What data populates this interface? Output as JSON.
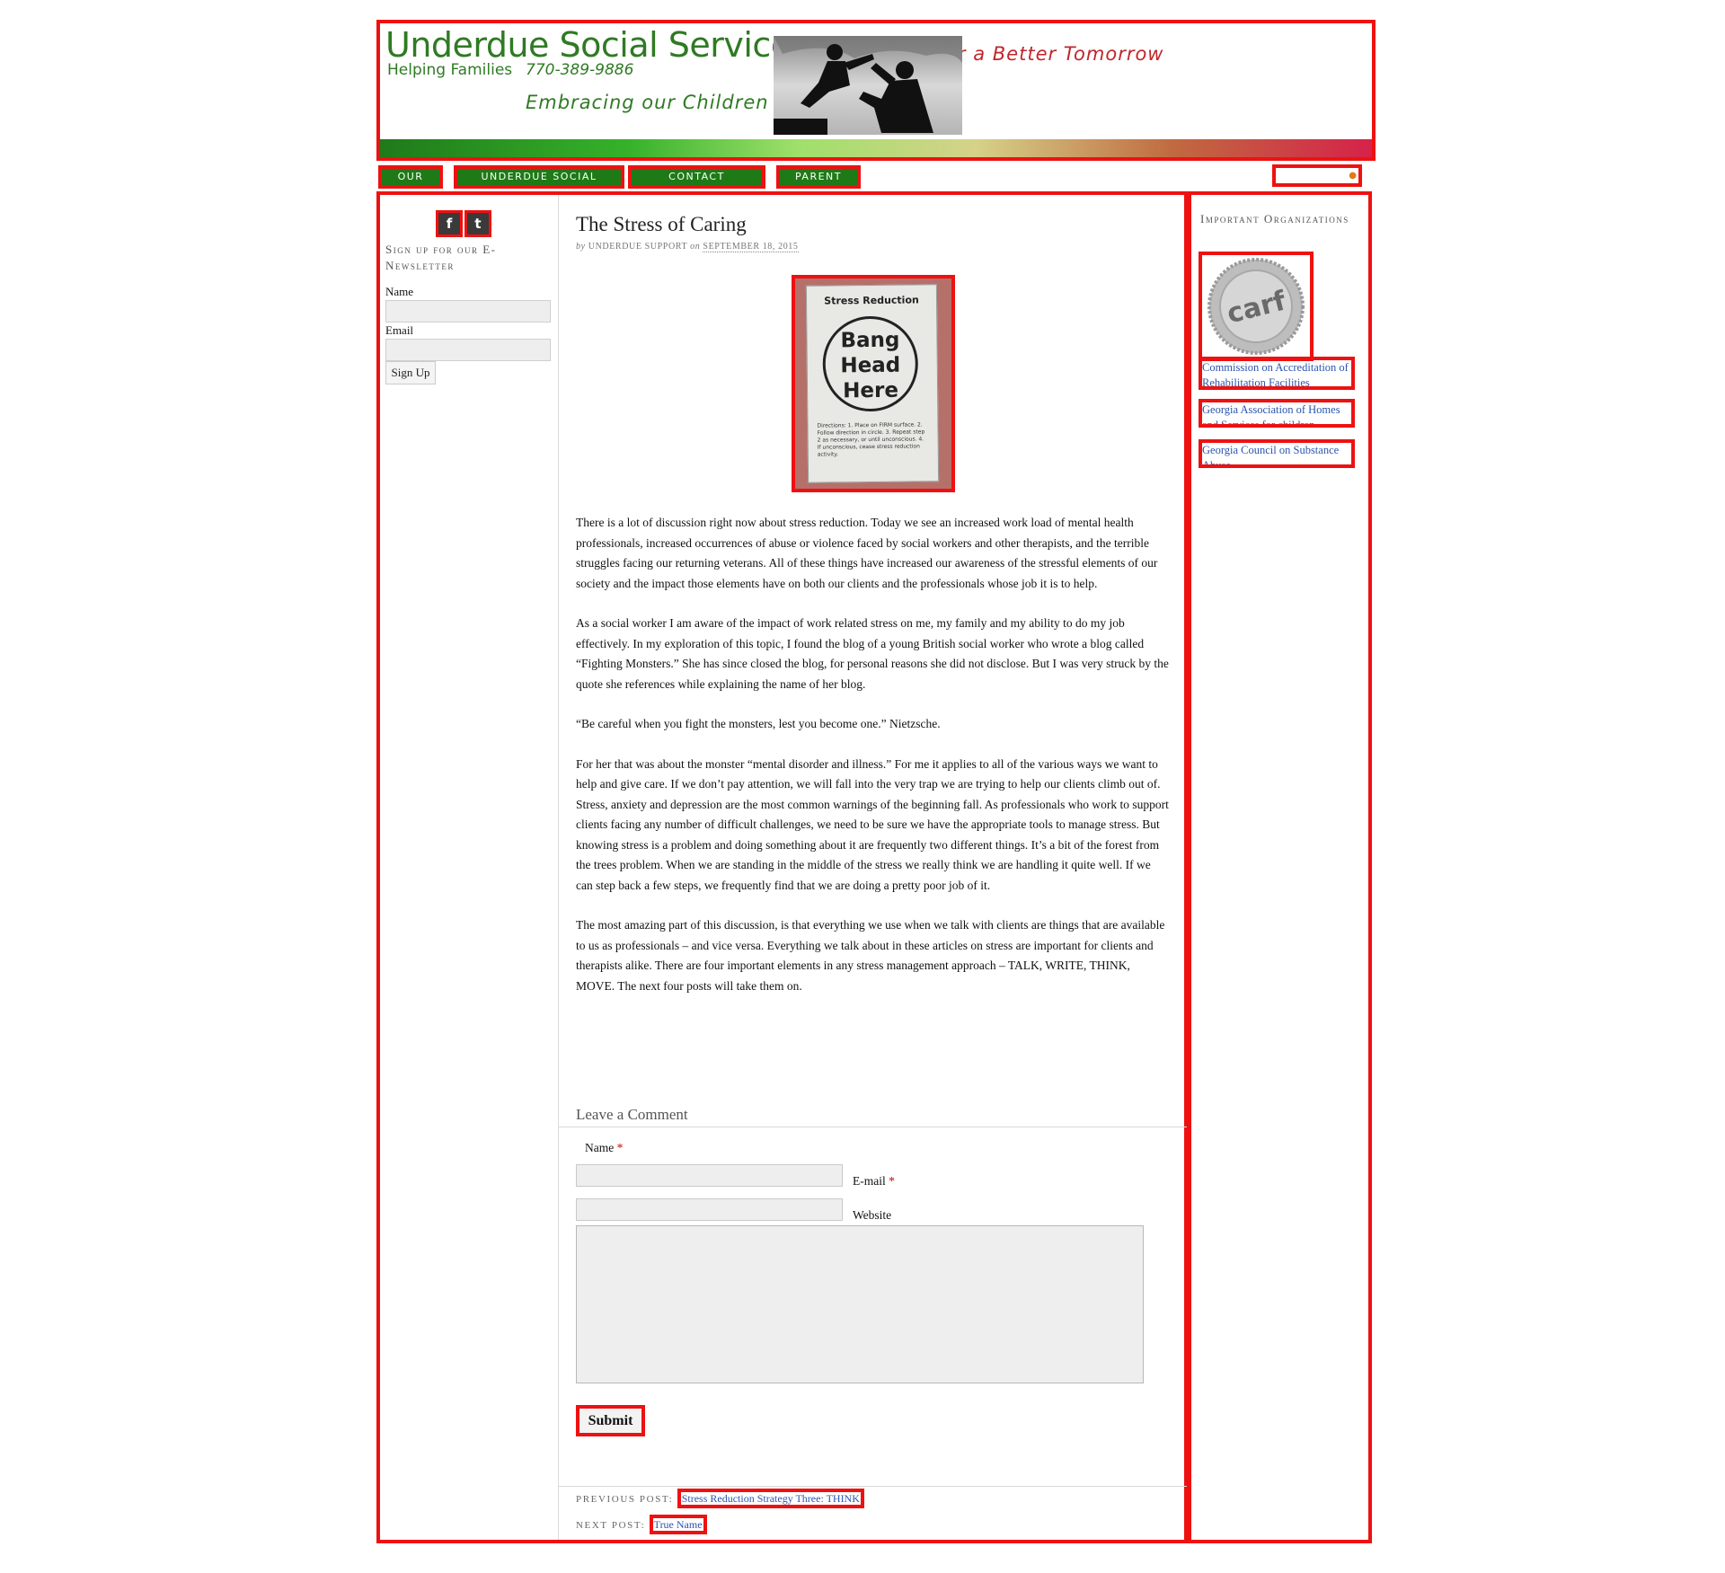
{
  "header": {
    "site_title": "Underdue Social Services",
    "tagline": "Helping Families",
    "phone": "770-389-9886",
    "slogan_green": "Embracing our Children",
    "slogan_red": "For a Better Tomorrow",
    "photo_icon": "header-photo-silhouette"
  },
  "nav": {
    "items": [
      {
        "label": "OUR BLOG"
      },
      {
        "label": "UNDERDUE SOCIAL SERVICES"
      },
      {
        "label": "CONTACT INFORMATION"
      },
      {
        "label": "PARENT TALK"
      }
    ],
    "search_icon": "rss-icon"
  },
  "sidebar": {
    "social": {
      "facebook": "f",
      "twitter": "t"
    },
    "newsletter_title": "Sign up for our E-Newsletter",
    "name_label": "Name",
    "email_label": "Email",
    "signup_button": "Sign Up"
  },
  "post": {
    "title": "The Stress of Caring",
    "by": "by",
    "author": "UNDERDUE SUPPORT",
    "on": "on",
    "date": "SEPTEMBER 18, 2015",
    "image": {
      "top_text": "Stress Reduction",
      "line1": "Bang",
      "line2": "Head",
      "line3": "Here",
      "directions": "Directions: 1. Place on FIRM surface. 2. Follow direction in circle. 3. Repeat step 2 as necessary, or until unconscious. 4. If unconscious, cease stress reduction activity."
    },
    "paragraphs": [
      "There is a lot of discussion right now about stress reduction. Today we see an increased work load of mental health professionals, increased occurrences of abuse or violence faced by social workers and other therapists, and the terrible struggles facing our returning veterans. All of these things have increased our awareness of the stressful elements of our society and the impact those elements have on both our clients and the professionals whose job it is to help.",
      "As a social worker I am aware of the impact of work related stress on me, my family and my ability to do my job effectively. In my exploration of this topic, I found the blog of a young British social worker who wrote a blog called “Fighting Monsters.” She has since closed the blog, for personal reasons she did not disclose. But I was very struck by the quote she references while explaining the name of her blog.",
      "“Be careful when you fight the monsters, lest you become one.” Nietzsche.",
      "For her that was about the monster “mental disorder and illness.” For me it applies to all of the various ways we want to help and give care. If we don’t pay attention, we will fall into the very trap we are trying to help our clients climb out of. Stress, anxiety and depression are the most common warnings of the beginning fall. As professionals who work to support clients facing any number of difficult challenges, we need to be sure we have the appropriate tools to manage stress. But knowing stress is a problem and doing something about it are frequently two different things. It’s a bit of the forest from the trees problem. When we are standing in the middle of the stress we really think we are handling it quite well. If we can step back a few steps, we frequently find that we are doing a pretty poor job of it.",
      "The most amazing part of this discussion, is that everything we use when we talk with clients are things that are available to us as professionals – and vice versa. Everything we talk about in these articles on stress are important for clients and therapists alike. There are four important elements in any stress management approach – TALK, WRITE, THINK, MOVE. The next four posts will take them on."
    ]
  },
  "comments": {
    "heading": "Leave a Comment",
    "name_label": "Name",
    "email_label": "E-mail",
    "website_label": "Website",
    "required_mark": "*",
    "submit_label": "Submit"
  },
  "post_nav": {
    "previous_label": "PREVIOUS POST:",
    "previous_link": "Stress Reduction Strategy Three: THINK",
    "next_label": "NEXT POST:",
    "next_link": "True Name"
  },
  "rightbar": {
    "title": "Important Organizations",
    "logo_text": "carf",
    "orgs": [
      {
        "label": "Commission on Accreditation of Rehabilitation Facilities"
      },
      {
        "label": "Georgia Association of Homes and Services for children"
      },
      {
        "label": "Georgia Council on Substance Abuse"
      }
    ]
  }
}
